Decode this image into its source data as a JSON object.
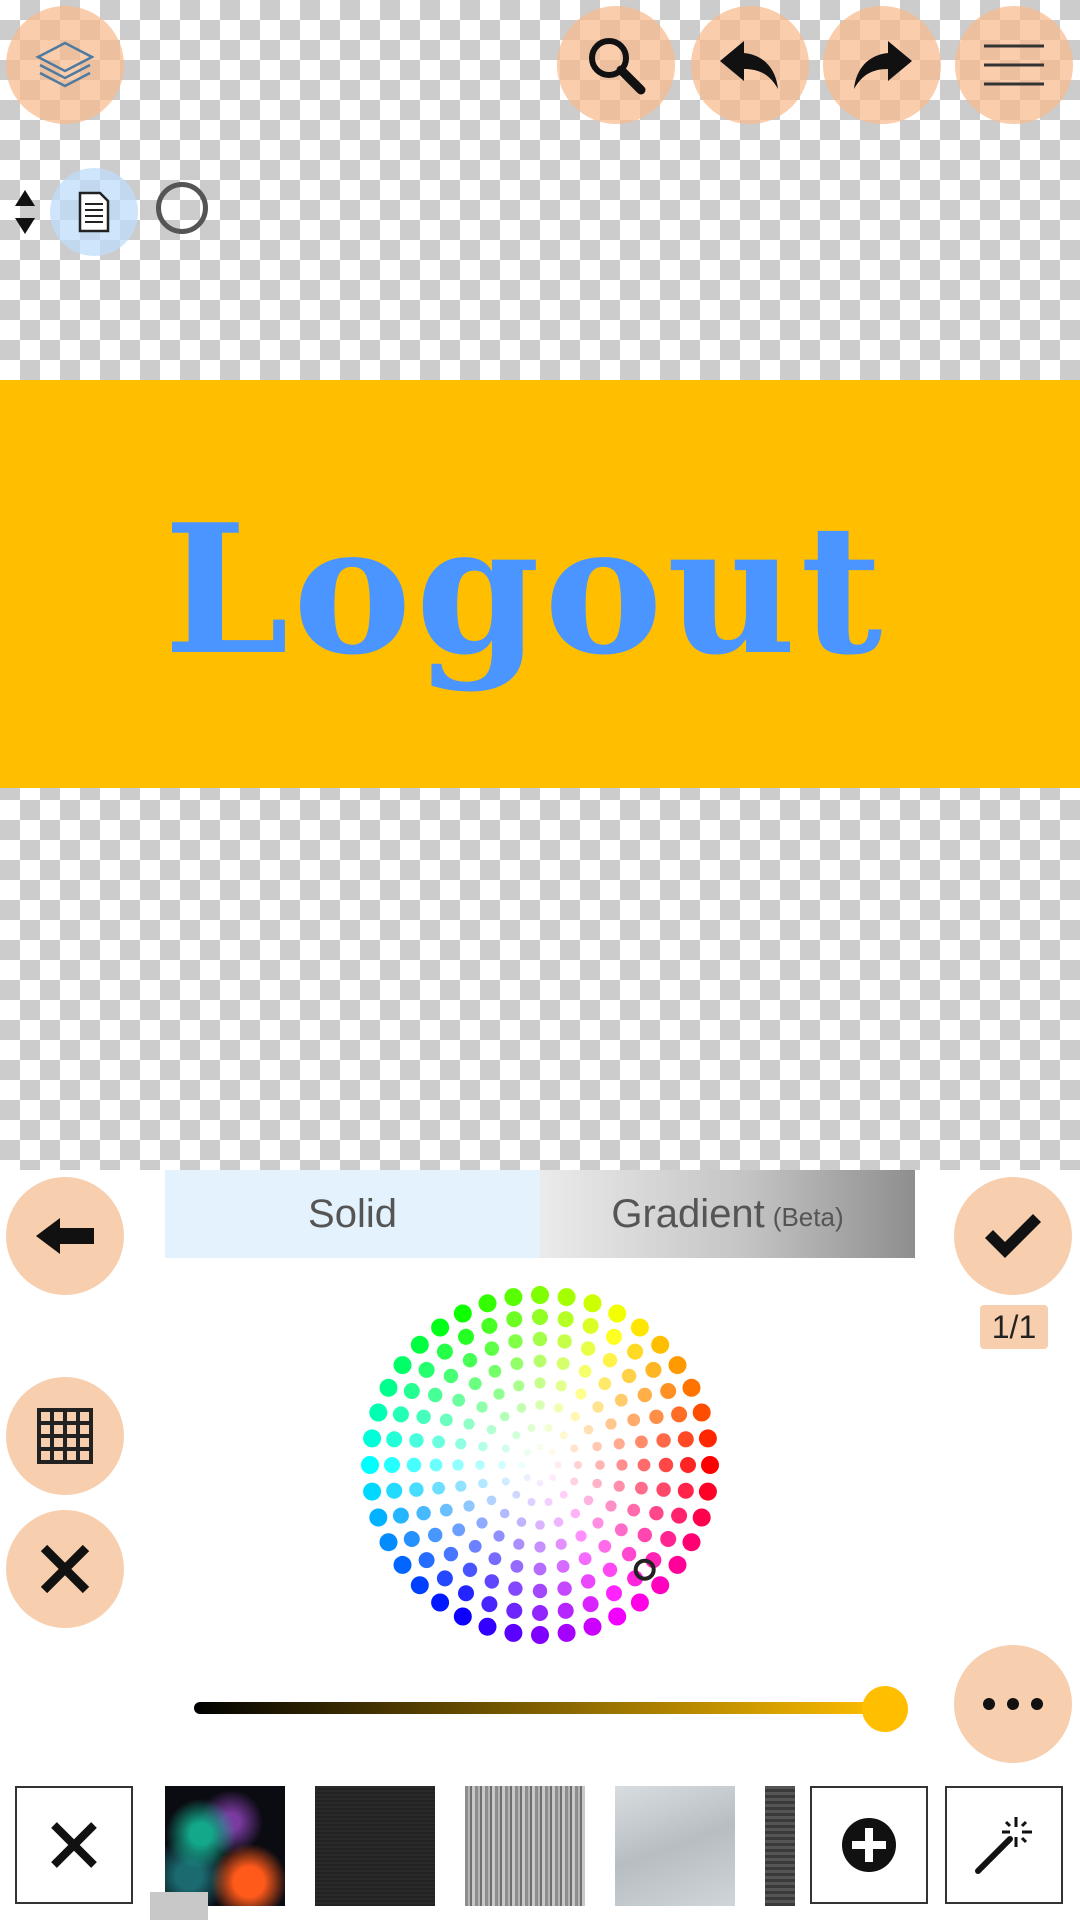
{
  "canvas": {
    "banner_text": "Logout",
    "banner_color": "#ffbf00",
    "text_color": "#4a95ff"
  },
  "toolbar": {
    "layers_icon": "layers-icon",
    "zoom_icon": "zoom-icon",
    "undo_icon": "undo-icon",
    "redo_icon": "redo-icon",
    "menu_icon": "menu-icon"
  },
  "color_panel": {
    "tabs": [
      {
        "label": "Solid",
        "selected": true
      },
      {
        "label": "Gradient",
        "suffix": "(Beta)",
        "selected": false
      }
    ],
    "page_count": "1/1",
    "brightness": 1.0,
    "selected_color": "#ffbf00",
    "accent": "#f8cfae"
  },
  "textures": [
    {
      "name": "nebula"
    },
    {
      "name": "fabric"
    },
    {
      "name": "wood"
    },
    {
      "name": "brushed-metal"
    },
    {
      "name": "dark-fabric"
    }
  ]
}
